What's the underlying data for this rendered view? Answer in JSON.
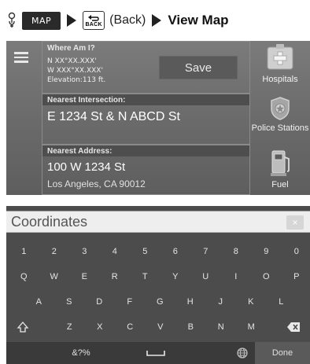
{
  "breadcrumb": {
    "voice_icon": "voice-command-icon",
    "map_button": "MAP",
    "back_key": "BACK",
    "back_text": "(Back)",
    "destination": "View Map"
  },
  "where_am_i": {
    "title": "Where Am I?",
    "lat": "N XX°XX.XXX'",
    "lon": "W XXX°XX.XXX'",
    "elevation": "Elevation:113 ft.",
    "save_label": "Save"
  },
  "intersection": {
    "title": "Nearest Intersection:",
    "value": "E 1234 St & N ABCD St"
  },
  "address": {
    "title": "Nearest Address:",
    "line1": "100 W 1234 St",
    "line2": "Los Angeles, CA 90012"
  },
  "categories": [
    {
      "label": "Hospitals",
      "icon": "hospital-icon"
    },
    {
      "label": "Police Stations",
      "icon": "police-badge-icon"
    },
    {
      "label": "Fuel",
      "icon": "fuel-pump-icon"
    }
  ],
  "keyboard": {
    "placeholder": "Coordinates",
    "clear_label": "×",
    "row1": [
      "1",
      "2",
      "3",
      "4",
      "5",
      "6",
      "7",
      "8",
      "9",
      "0"
    ],
    "row2": [
      "Q",
      "W",
      "E",
      "R",
      "T",
      "Y",
      "U",
      "I",
      "O",
      "P"
    ],
    "row3": [
      "A",
      "S",
      "D",
      "F",
      "G",
      "H",
      "J",
      "K",
      "L"
    ],
    "row4": [
      "Z",
      "X",
      "C",
      "V",
      "B",
      "N",
      "M"
    ],
    "symbols_label": "&?%",
    "done_label": "Done"
  }
}
